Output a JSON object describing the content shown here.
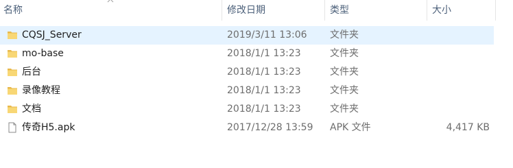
{
  "columns": {
    "name": "名称",
    "date": "修改日期",
    "type": "类型",
    "size": "大小"
  },
  "rows": [
    {
      "name": "CQSJ_Server",
      "date": "2019/3/11 13:06",
      "type": "文件夹",
      "size": "",
      "icon": "folder-icon",
      "selected": true
    },
    {
      "name": "mo-base",
      "date": "2018/1/1 13:23",
      "type": "文件夹",
      "size": "",
      "icon": "folder-icon"
    },
    {
      "name": "后台",
      "date": "2018/1/1 13:23",
      "type": "文件夹",
      "size": "",
      "icon": "folder-icon"
    },
    {
      "name": "录像教程",
      "date": "2018/1/1 13:23",
      "type": "文件夹",
      "size": "",
      "icon": "folder-icon"
    },
    {
      "name": "文档",
      "date": "2018/1/1 13:23",
      "type": "文件夹",
      "size": "",
      "icon": "folder-icon"
    },
    {
      "name": "传奇H5.apk",
      "date": "2017/12/28 13:59",
      "type": "APK 文件",
      "size": "4,417 KB",
      "icon": "file-icon"
    }
  ],
  "colors": {
    "folder": "#f8d775",
    "folder_dark": "#e8b84a",
    "selection": "#e5f3ff",
    "header_text": "#4c607a"
  }
}
